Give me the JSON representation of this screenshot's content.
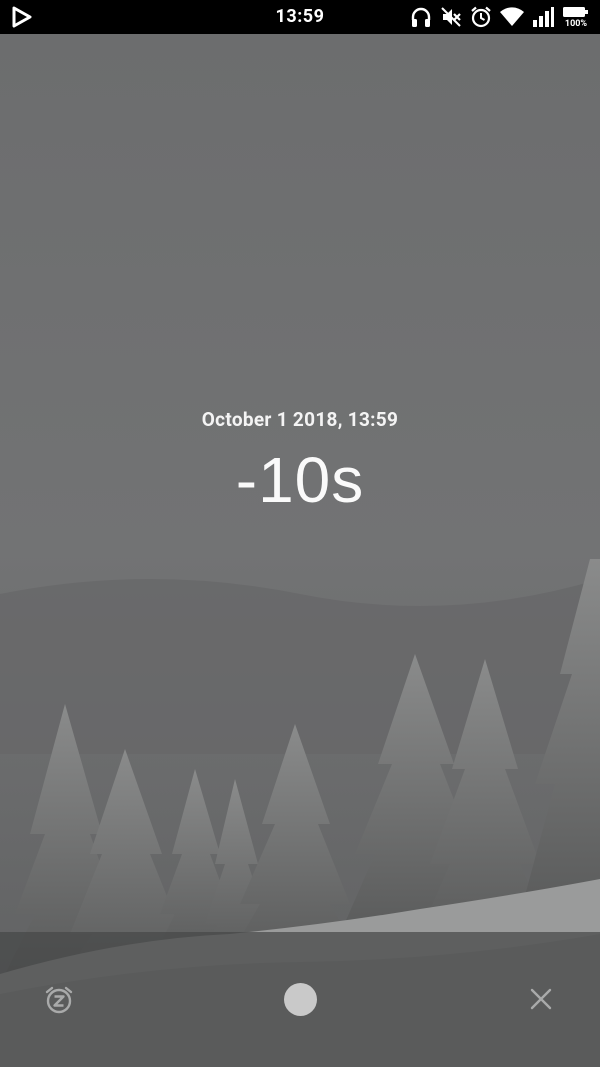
{
  "status_bar": {
    "time": "13:59",
    "battery_percent": "100%",
    "icons": [
      "play-store-notification-icon",
      "headphones-icon",
      "mute-icon",
      "alarm-icon",
      "wifi-icon",
      "signal-icon",
      "battery-icon"
    ]
  },
  "alarm": {
    "date_time": "October 1 2018, 13:59",
    "countdown": "-10s"
  },
  "controls": {
    "snooze_icon": "snooze-icon",
    "dismiss_icon": "dismiss-circle",
    "close_icon": "close-icon"
  },
  "colors": {
    "status_bar": "#000000",
    "sky": "#6e6f70",
    "bottom_bar": "#4d4f4f",
    "dismiss_dot": "#c9c9c9"
  }
}
